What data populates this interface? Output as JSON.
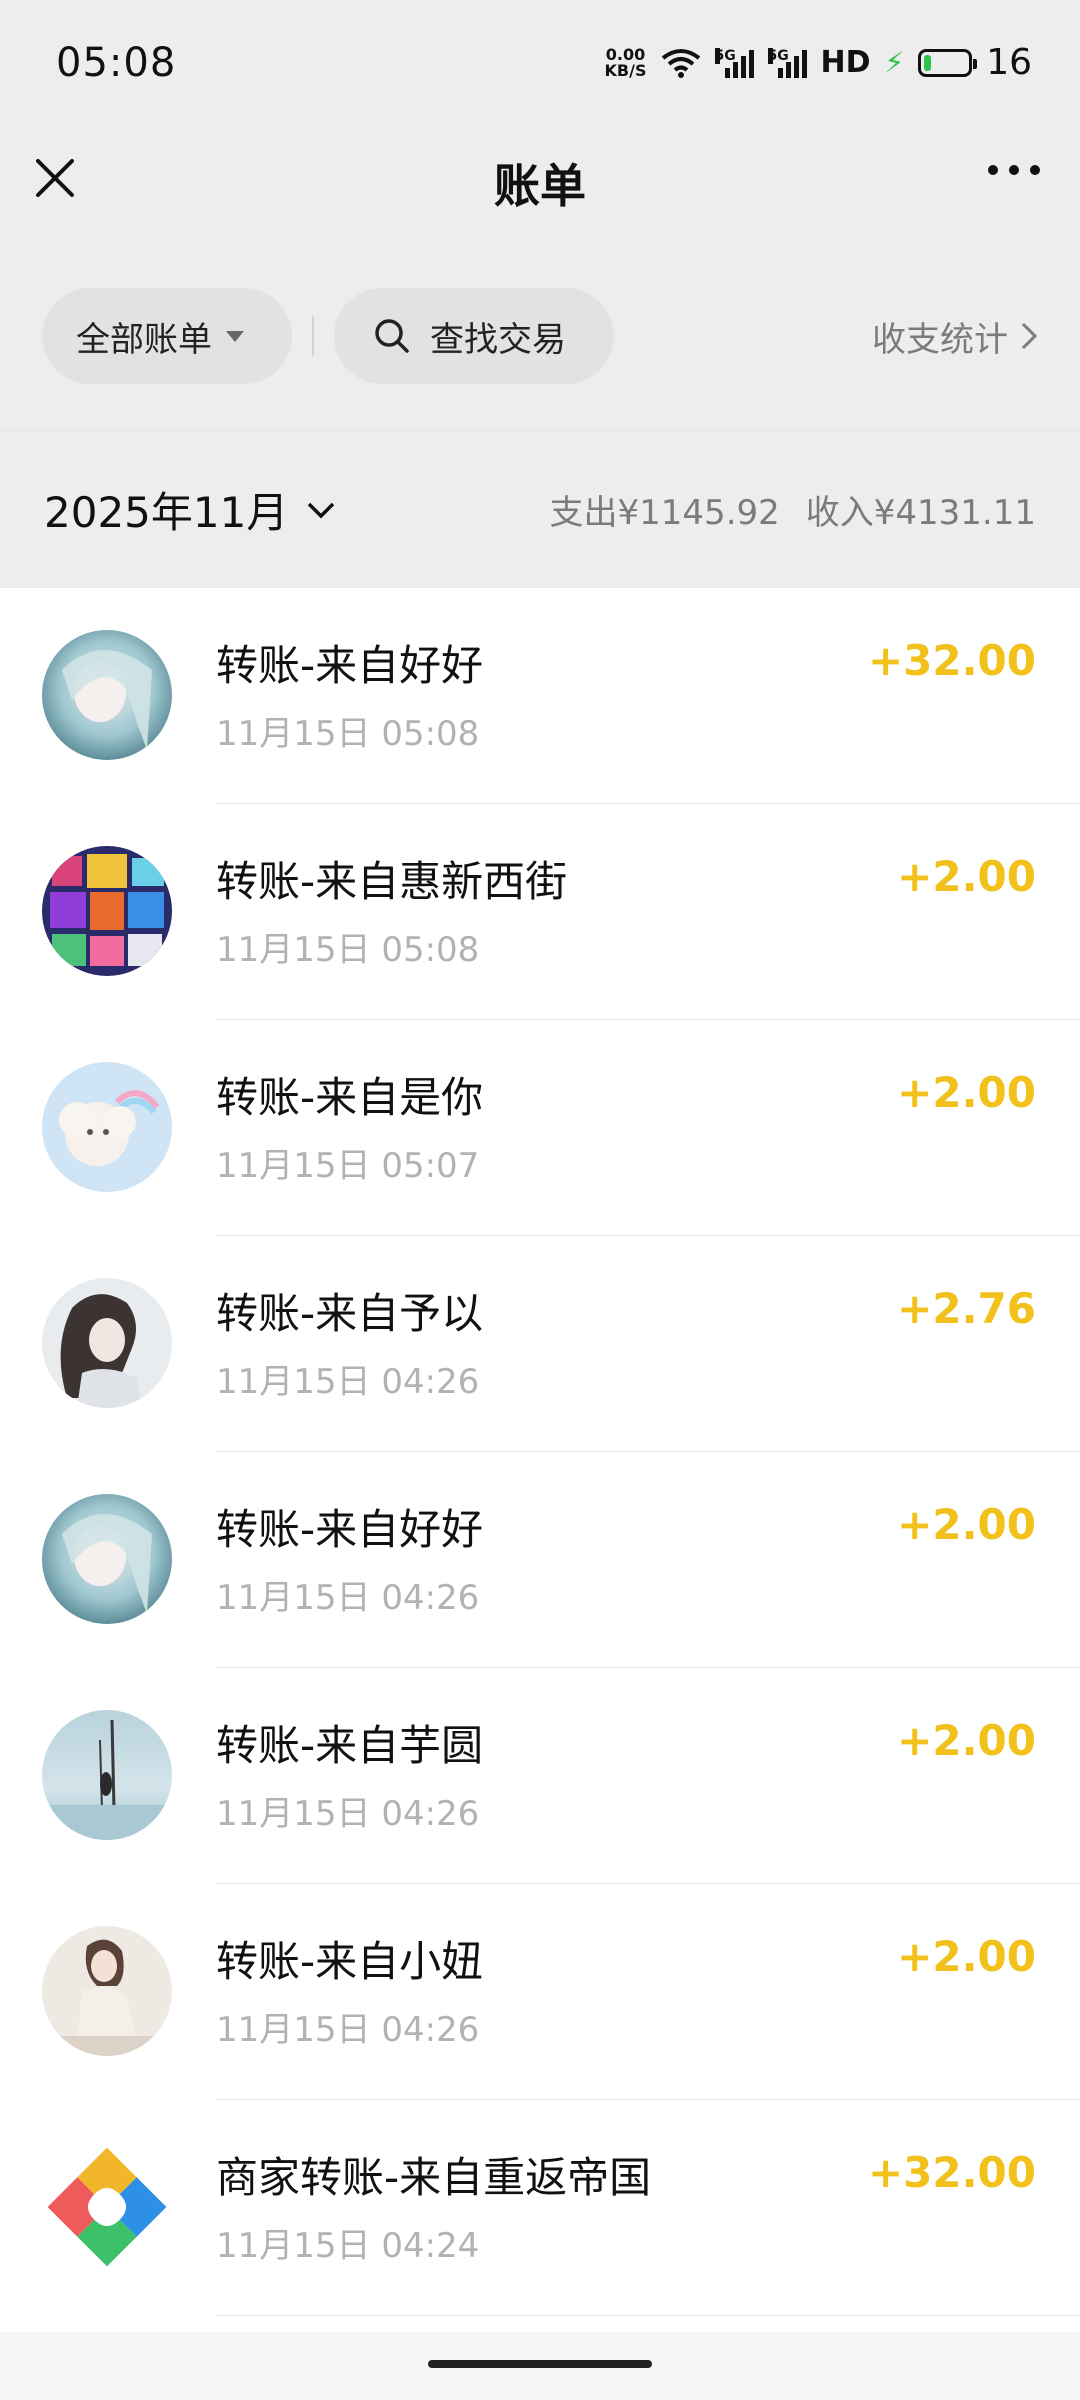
{
  "status_bar": {
    "time": "05:08",
    "net_speed_value": "0.00",
    "net_speed_unit": "KB/S",
    "sim1_label": "5G",
    "sim2_label": "5G",
    "hd_label": "HD",
    "battery_level": "16",
    "battery_fraction": 0.16
  },
  "nav": {
    "title": "账单",
    "close_icon": "close-icon",
    "more_icon": "more-icon"
  },
  "filters": {
    "all_bills_label": "全部账单",
    "search_label": "查找交易",
    "stats_label": "收支统计"
  },
  "month_header": {
    "month": "2025年11月",
    "expense": "支出¥1145.92",
    "income": "收入¥4131.11"
  },
  "transactions": [
    {
      "title": "转账-来自好好",
      "time": "11月15日 05:08",
      "amount": "+32.00",
      "avatar": "avatar-anime-girl-teal"
    },
    {
      "title": "转账-来自惠新西街",
      "time": "11月15日 05:08",
      "amount": "+2.00",
      "avatar": "avatar-colorful-collage"
    },
    {
      "title": "转账-来自是你",
      "time": "11月15日 05:07",
      "amount": "+2.00",
      "avatar": "avatar-cloud-rainbow"
    },
    {
      "title": "转账-来自予以",
      "time": "11月15日 04:26",
      "amount": "+2.76",
      "avatar": "avatar-anime-girl-dark"
    },
    {
      "title": "转账-来自好好",
      "time": "11月15日 04:26",
      "amount": "+2.00",
      "avatar": "avatar-anime-girl-teal"
    },
    {
      "title": "转账-来自芋圆",
      "time": "11月15日 04:26",
      "amount": "+2.00",
      "avatar": "avatar-sea-figure"
    },
    {
      "title": "转账-来自小妞",
      "time": "11月15日 04:26",
      "amount": "+2.00",
      "avatar": "avatar-girl-photo"
    },
    {
      "title": "商家转账-来自重返帝国",
      "time": "11月15日 04:24",
      "amount": "+32.00",
      "avatar": "avatar-game-logo"
    }
  ],
  "colors": {
    "background": "#ededed",
    "amount": "#f2c11b",
    "secondary_text": "#b2b2b2"
  }
}
